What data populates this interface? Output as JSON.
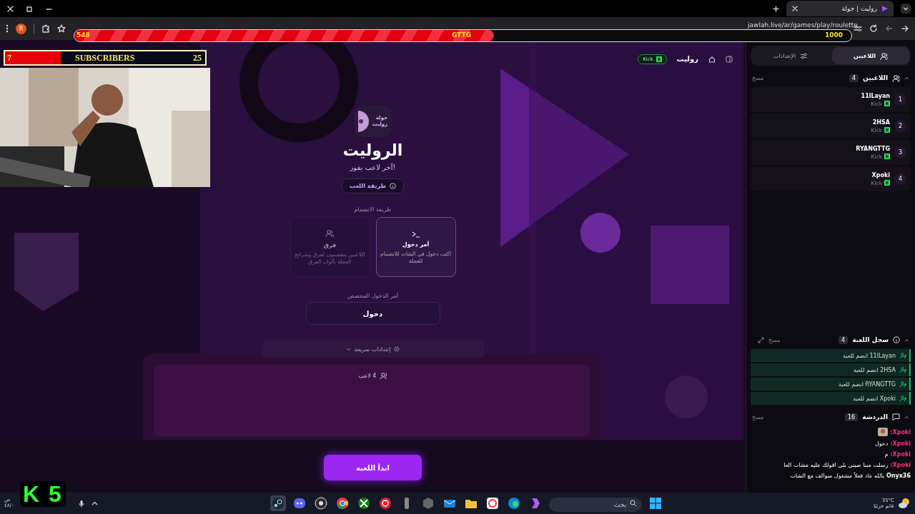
{
  "browser": {
    "tab_title": "روليت | جولة",
    "url": "jawlah.live/ar/games/play/roulette",
    "profile_initial": "R"
  },
  "stream_overlay": {
    "goal_bar": {
      "current": "548",
      "label": "GTTG",
      "target": "1000",
      "level": 0.54
    },
    "subscribers": {
      "current": "7",
      "label": "SUBSCRIBERS",
      "target": "25",
      "level": 0.28
    },
    "badge": "K 5"
  },
  "header": {
    "title": "روليت",
    "platform": "Kick"
  },
  "game": {
    "logo_lines": [
      "جولة",
      "روليت"
    ],
    "title": "الروليت",
    "subtitle": "آخر لاعب يفوز!",
    "how_to_play": "طريقة اللعب",
    "join_label": "طريقة الانضمام",
    "join_modes": [
      {
        "kind": "command",
        "title": "أمر دخول",
        "description": "اكتب دخول في الشات للانضمام للعجلة",
        "selected": true
      },
      {
        "kind": "teams",
        "title": "فرق",
        "description": "اللاعبين ينقسمون لفرق وشرائح العجلة بألوان الفرق",
        "selected": false
      }
    ],
    "custom_command_label": "أمر الدخول المخصص",
    "custom_command_value": "دخول",
    "quick_settings": "إعدادات سريعة",
    "player_count": "4 لاعب",
    "start_button": "ابدأ اللعبة"
  },
  "sidebar_tabs": [
    {
      "label": "اللاعبين",
      "kind": "players",
      "selected": true
    },
    {
      "label": "الإعدادات",
      "kind": "settings",
      "selected": false
    }
  ],
  "players_panel": {
    "title": "اللاعبين",
    "count": "4",
    "clear": "مسح",
    "players": [
      {
        "rank": "1",
        "name": "11lLayan",
        "platform": "Kick"
      },
      {
        "rank": "2",
        "name": "2HSA",
        "platform": "Kick"
      },
      {
        "rank": "3",
        "name": "RYANGTTG",
        "platform": "Kick"
      },
      {
        "rank": "4",
        "name": "Xpoki",
        "platform": "Kick"
      }
    ]
  },
  "log_panel": {
    "title": "سجل اللعبة",
    "count": "4",
    "clear": "مسح",
    "entries": [
      "11lLayan انضم للعبة",
      "2HSA انضم للعبة",
      "RYANGTTG انضم للعبة",
      "Xpoki انضم للعبة"
    ]
  },
  "chat_panel": {
    "title": "الدردشة",
    "count": "16",
    "clear": "مسح",
    "messages": [
      {
        "kind": "emote",
        "user": "Xpoki:",
        "color": "#ff2e78"
      },
      {
        "kind": "text",
        "user": "Xpoki:",
        "text": "دخول",
        "color": "#ff2e78"
      },
      {
        "kind": "text",
        "user": "Xpoki:",
        "text": "م",
        "color": "#ff2e78"
      },
      {
        "kind": "text",
        "user": "Xpoki:",
        "text": "رسلت مبنا صيني بلي اقولك عليه مشات العا",
        "color": "#ff2e78"
      },
      {
        "kind": "text",
        "user": "Onyx36",
        "text": "يالله عاد فعلاً مشغول سوالف مع الشات",
        "color": "#ffffff"
      }
    ]
  },
  "taskbar": {
    "clock_period": "ص",
    "clock_time": "٤٨/٠",
    "search_placeholder": "بحث",
    "weather": {
      "temp": "35°C",
      "condition": "غائم جزئيًا"
    }
  }
}
